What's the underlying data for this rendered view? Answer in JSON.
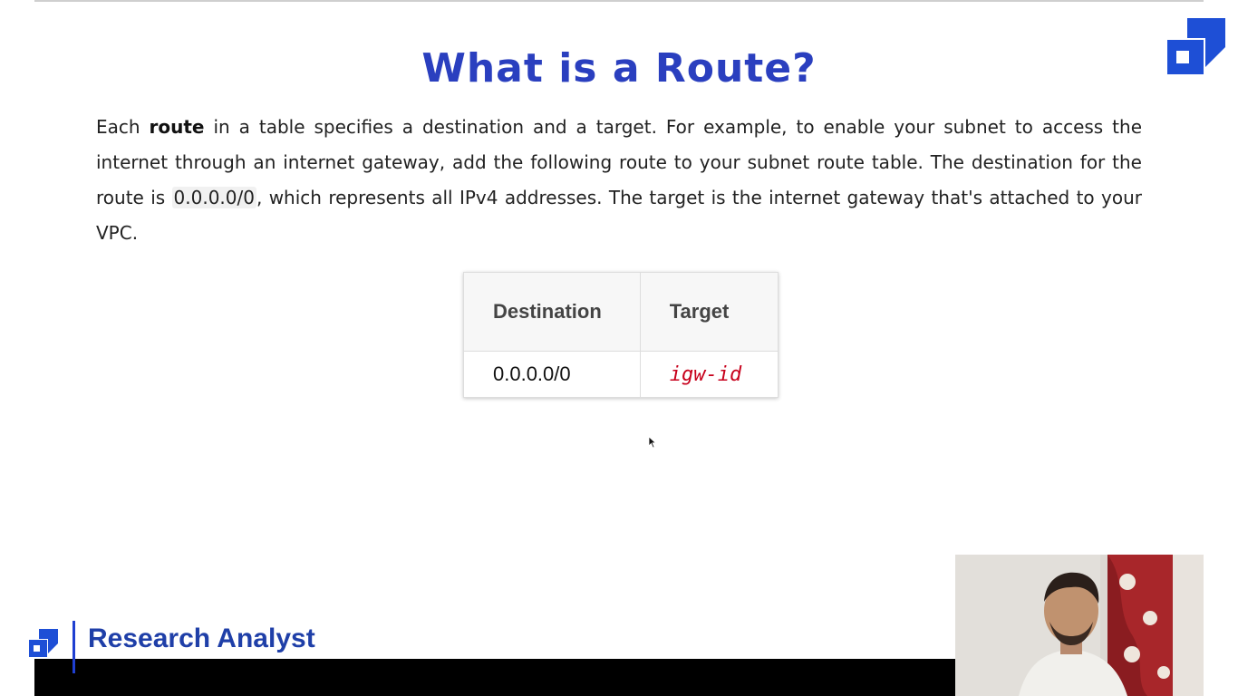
{
  "slide": {
    "title": "What is a Route?",
    "paragraph": {
      "pre": "Each ",
      "bold": "route",
      "mid": " in a table specifies a destination and a target. For example, to enable your subnet to access the internet through an internet gateway, add the following route to your subnet route table. The destination for the route is ",
      "code": "0.0.0.0/0",
      "post": ", which represents all IPv4 addresses. The target is the internet gateway that's attached to your VPC."
    },
    "table": {
      "headers": [
        "Destination",
        "Target"
      ],
      "rows": [
        [
          "0.0.0.0/0",
          "igw-id"
        ]
      ]
    }
  },
  "branding": {
    "text": "Research Analyst",
    "logo_icon": "cube-logo-icon",
    "color": "#1f3fa8"
  },
  "colors": {
    "title": "#2a3fbf",
    "target_value": "#c7001b",
    "footer_bar": "#000000"
  }
}
